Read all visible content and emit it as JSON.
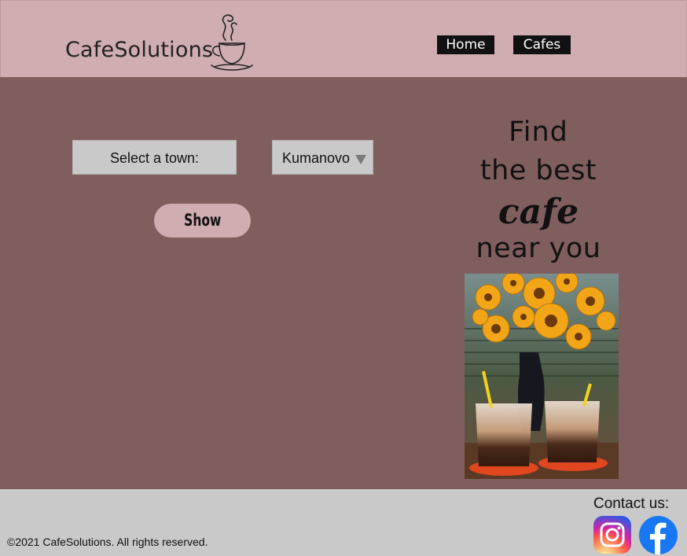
{
  "header": {
    "logo_text": "CafeSolutions",
    "nav": {
      "home": "Home",
      "cafes": "Cafes"
    }
  },
  "filter": {
    "label": "Select a town:",
    "selected_town": "Kumanovo",
    "show_button": "Show"
  },
  "tagline": {
    "line1": "Find",
    "line2": "the best",
    "line3": "cafe",
    "line4": "near you"
  },
  "footer": {
    "copyright": "©2021 CafeSolutions. All rights reserved.",
    "contact_label": "Contact us:"
  },
  "icons": {
    "logo": "coffee-cup-icon",
    "dropdown": "dropdown-arrow-icon",
    "instagram": "instagram-icon",
    "facebook": "facebook-icon"
  },
  "colors": {
    "header_bg": "#cfadb0",
    "main_bg": "#815e5e",
    "footer_bg": "#c9c9c9",
    "nav_bg": "#111111"
  }
}
